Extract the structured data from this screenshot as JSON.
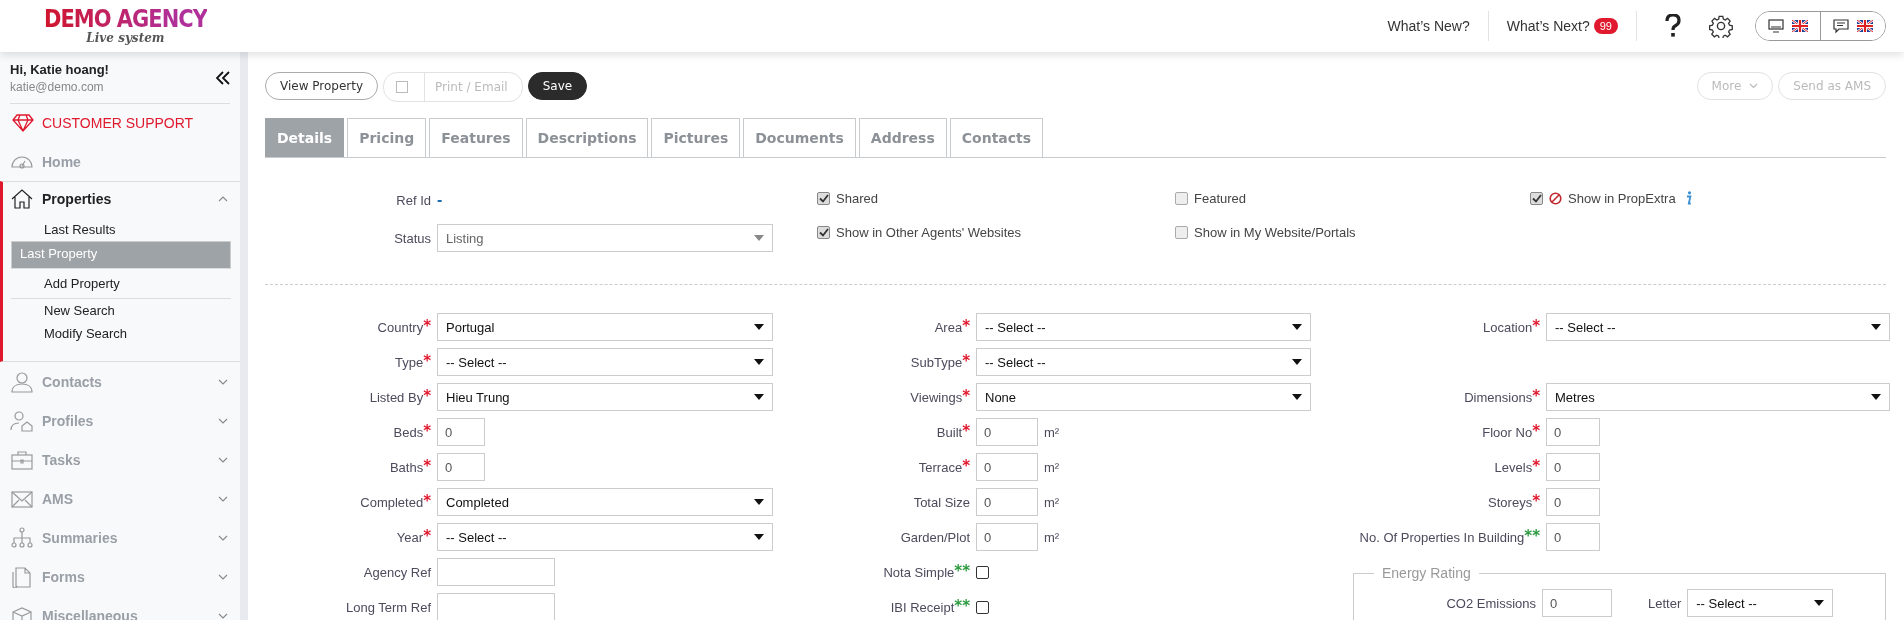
{
  "header": {
    "logo": {
      "title": "DEMO AGENCY",
      "subtitle": "Live system"
    },
    "links": [
      {
        "label": "What’s New?"
      },
      {
        "label": "What’s Next?",
        "badge": "99"
      }
    ]
  },
  "sidebar": {
    "user": {
      "greeting": "Hi, Katie hoang!",
      "email": "katie@demo.com"
    },
    "support": {
      "label": "CUSTOMER SUPPORT"
    },
    "items": [
      {
        "label": "Home",
        "kind": "link"
      },
      {
        "label": "Properties",
        "kind": "group",
        "expanded": true,
        "children": [
          {
            "label": "Last Results",
            "selected": false
          },
          {
            "label": "Last Property",
            "selected": true
          },
          {
            "label": "Add Property",
            "selected": false
          },
          {
            "label": "New Search",
            "selected": false
          },
          {
            "label": "Modify Search",
            "selected": false
          }
        ]
      },
      {
        "label": "Contacts",
        "kind": "group",
        "expanded": false
      },
      {
        "label": "Profiles",
        "kind": "group",
        "expanded": false
      },
      {
        "label": "Tasks",
        "kind": "group",
        "expanded": false
      },
      {
        "label": "AMS",
        "kind": "group",
        "expanded": false
      },
      {
        "label": "Summaries",
        "kind": "group",
        "expanded": false
      },
      {
        "label": "Forms",
        "kind": "group",
        "expanded": false
      },
      {
        "label": "Miscellaneous",
        "kind": "group",
        "expanded": false
      }
    ]
  },
  "toolbar": {
    "buttons": [
      {
        "label": "View Property",
        "kind": "outline",
        "disabled": false
      },
      {
        "label": "Print / Email",
        "kind": "check",
        "disabled": true,
        "checked": false
      },
      {
        "label": "Save",
        "kind": "primary",
        "disabled": false
      }
    ],
    "right_buttons": [
      {
        "label": "More",
        "kind": "dropdown",
        "disabled": true
      },
      {
        "label": "Send as AMS",
        "kind": "outline",
        "disabled": true
      }
    ]
  },
  "tabs": [
    {
      "label": "Details",
      "selected": true
    },
    {
      "label": "Pricing",
      "selected": false
    },
    {
      "label": "Features",
      "selected": false
    },
    {
      "label": "Descriptions",
      "selected": false
    },
    {
      "label": "Pictures",
      "selected": false
    },
    {
      "label": "Documents",
      "selected": false
    },
    {
      "label": "Address",
      "selected": false
    },
    {
      "label": "Contacts",
      "selected": false
    }
  ],
  "summary": {
    "ref_id": {
      "label": "Ref Id",
      "value": "-"
    },
    "status": {
      "label": "Status",
      "value": "Listing",
      "disabled": true
    },
    "flags": [
      {
        "label": "Shared",
        "checked": true,
        "kind": "plain"
      },
      {
        "label": "Featured",
        "checked": false,
        "kind": "plain"
      },
      {
        "label": "Show in PropExtra",
        "checked": true,
        "kind": "portal"
      },
      {
        "label": "Show in Other Agents' Websites",
        "checked": true,
        "kind": "plain"
      },
      {
        "label": "Show in My Website/Portals",
        "checked": false,
        "kind": "plain"
      }
    ]
  },
  "form": {
    "columns": [
      {
        "sections": [
          {
            "fields": [
              {
                "label": "Country",
                "marker": {
                  "text": "*",
                  "color": "#e0182d"
                },
                "kind": "select",
                "value": "Portugal"
              },
              {
                "label": "Type",
                "marker": {
                  "text": "*",
                  "color": "#e0182d"
                },
                "kind": "select",
                "value": "-- Select --"
              },
              {
                "label": "Listed By",
                "marker": {
                  "text": "*",
                  "color": "#e0182d"
                },
                "kind": "select",
                "value": "Hieu Trung"
              },
              {
                "label": "Beds",
                "marker": {
                  "text": "*",
                  "color": "#e0182d"
                },
                "kind": "number",
                "value": "0"
              },
              {
                "label": "Baths",
                "marker": {
                  "text": "*",
                  "color": "#e0182d"
                },
                "kind": "number",
                "value": "0"
              },
              {
                "label": "Completed",
                "marker": {
                  "text": "*",
                  "color": "#e0182d"
                },
                "kind": "select",
                "value": "Completed"
              },
              {
                "label": "Year",
                "marker": {
                  "text": "*",
                  "color": "#e0182d"
                },
                "kind": "select",
                "value": "-- Select --"
              },
              {
                "label": "Agency Ref",
                "kind": "text"
              },
              {
                "label": "Long Term Ref",
                "kind": "text"
              }
            ]
          }
        ]
      },
      {
        "sections": [
          {
            "fields": [
              {
                "label": "Area",
                "marker": {
                  "text": "*",
                  "color": "#e0182d"
                },
                "kind": "select",
                "value": "-- Select --"
              },
              {
                "label": "SubType",
                "marker": {
                  "text": "*",
                  "color": "#e0182d"
                },
                "kind": "select",
                "value": "-- Select --"
              },
              {
                "label": "Viewings",
                "marker": {
                  "text": "*",
                  "color": "#e0182d"
                },
                "kind": "select",
                "value": "None"
              },
              {
                "label": "Built",
                "marker": {
                  "text": "*",
                  "color": "#e0182d"
                },
                "kind": "number",
                "value": "0",
                "unit": "m²"
              },
              {
                "label": "Terrace",
                "marker": {
                  "text": "*",
                  "color": "#e0182d"
                },
                "kind": "number",
                "value": "0",
                "unit": "m²"
              },
              {
                "label": "Total Size",
                "kind": "number",
                "value": "0",
                "unit": "m²"
              },
              {
                "label": "Garden/Plot",
                "kind": "number",
                "value": "0",
                "unit": "m²"
              },
              {
                "label": "Nota Simple",
                "marker": {
                  "text": "**",
                  "color": "#2a9a3e"
                },
                "kind": "checkbox",
                "checked": false
              },
              {
                "label": "IBI Receipt",
                "marker": {
                  "text": "**",
                  "color": "#2a9a3e"
                },
                "kind": "checkbox",
                "checked": false
              }
            ]
          }
        ]
      },
      {
        "sections": [
          {
            "fields": [
              {
                "label": "Location",
                "marker": {
                  "text": "*",
                  "color": "#e0182d"
                },
                "kind": "select",
                "value": "-- Select --"
              }
            ]
          },
          {
            "fields": [
              {
                "label": "Dimensions",
                "marker": {
                  "text": "*",
                  "color": "#e0182d"
                },
                "kind": "select",
                "value": "Metres"
              },
              {
                "label": "Floor No",
                "marker": {
                  "text": "*",
                  "color": "#e0182d"
                },
                "kind": "number",
                "value": "0"
              },
              {
                "label": "Levels",
                "marker": {
                  "text": "*",
                  "color": "#e0182d"
                },
                "kind": "number",
                "value": "0"
              },
              {
                "label": "Storeys",
                "marker": {
                  "text": "*",
                  "color": "#e0182d"
                },
                "kind": "number",
                "value": "0"
              },
              {
                "label": "No. Of Properties In Building",
                "marker": {
                  "text": "**",
                  "color": "#2a9a3e"
                },
                "kind": "number",
                "value": "0"
              }
            ]
          }
        ],
        "energy_rating": {
          "title": "Energy Rating",
          "fields": [
            {
              "label": "CO2 Emissions",
              "kind": "number",
              "value": "0"
            },
            {
              "label": "Letter",
              "kind": "select",
              "value": "-- Select --"
            }
          ]
        }
      }
    ]
  }
}
